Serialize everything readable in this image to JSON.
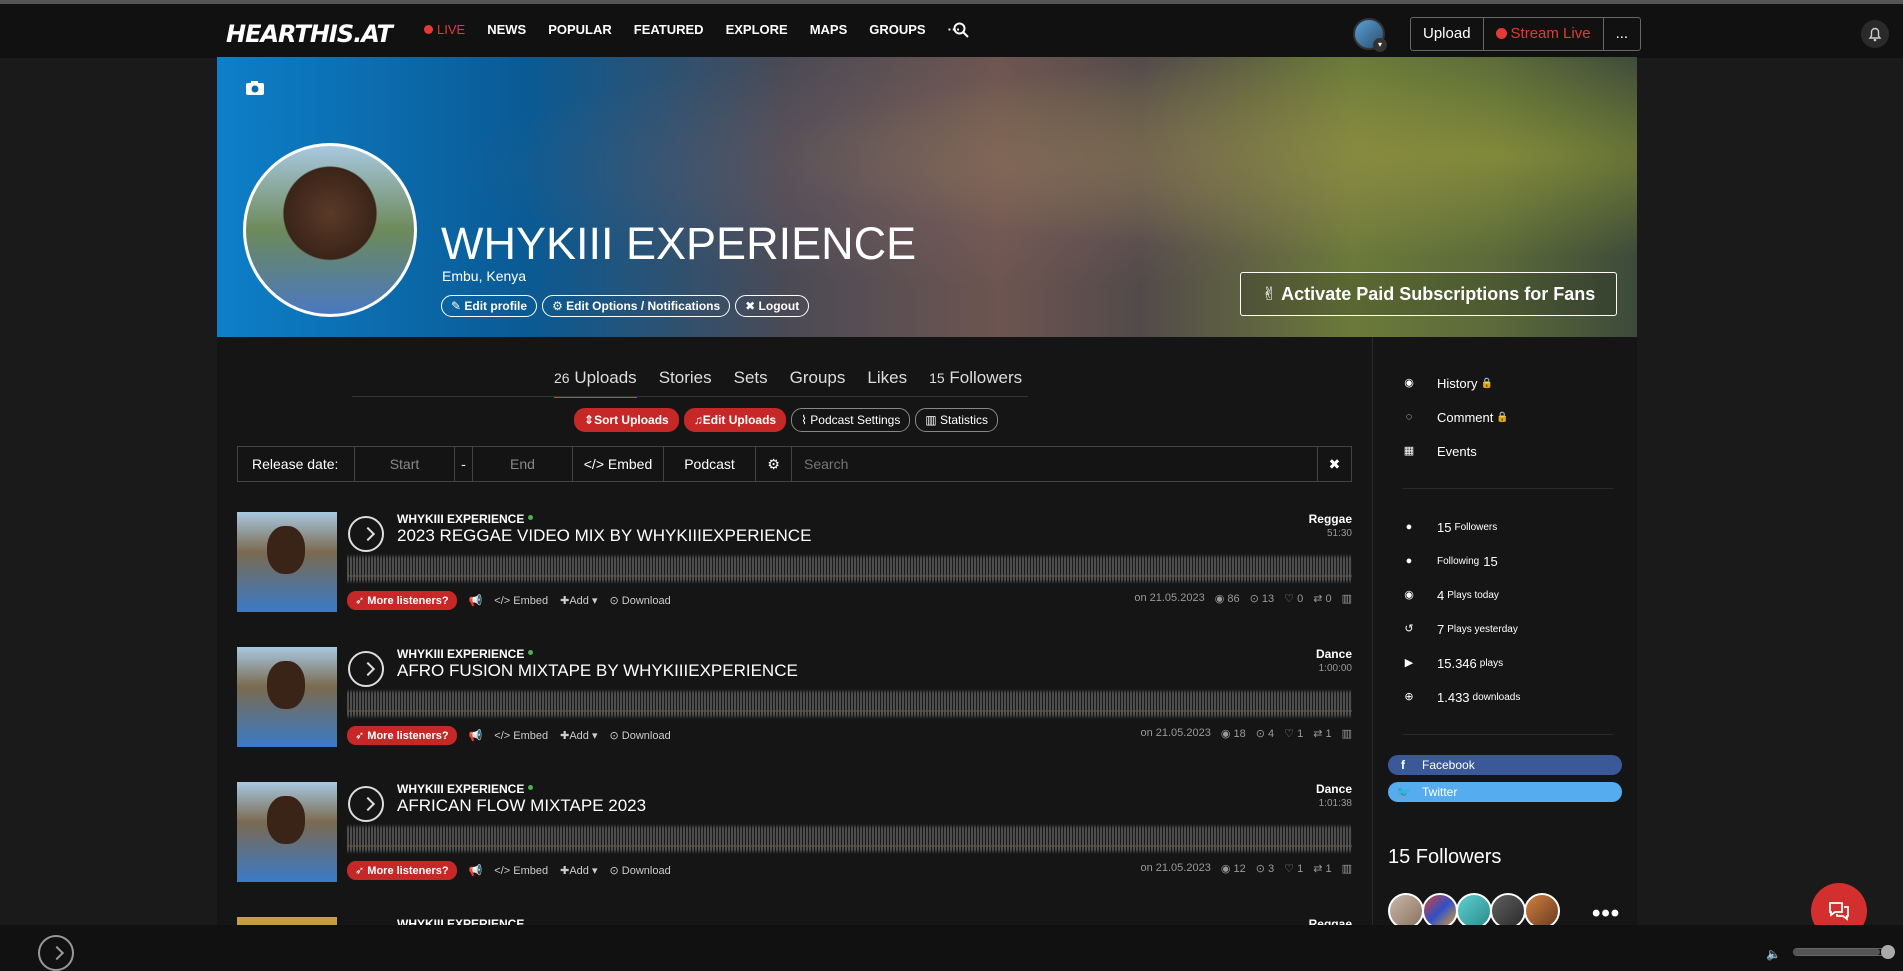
{
  "topbar": {
    "logo": "HEARTHIS.AT",
    "nav": [
      "LIVE",
      "NEWS",
      "POPULAR",
      "FEATURED",
      "EXPLORE",
      "MAPS",
      "GROUPS",
      "···"
    ],
    "upload_label": "Upload",
    "stream_label": "Stream Live",
    "more_label": "..."
  },
  "profile": {
    "name": "WHYKIII EXPERIENCE",
    "location": "Embu, Kenya",
    "edit_profile": "Edit profile",
    "edit_options": "Edit Options / Notifications",
    "logout": "Logout",
    "paid_subscriptions": "Activate Paid Subscriptions for Fans"
  },
  "tabs": [
    {
      "count": "26",
      "label": "Uploads"
    },
    {
      "count": "",
      "label": "Stories"
    },
    {
      "count": "",
      "label": "Sets"
    },
    {
      "count": "",
      "label": "Groups"
    },
    {
      "count": "",
      "label": "Likes"
    },
    {
      "count": "15",
      "label": "Followers"
    }
  ],
  "subactions": {
    "sort": "Sort Uploads",
    "edit": "Edit Uploads",
    "podcast_settings": "Podcast Settings",
    "statistics": "Statistics"
  },
  "filter": {
    "label": "Release date:",
    "start": "Start",
    "dash": "-",
    "end": "End",
    "embed": "Embed",
    "podcast": "Podcast",
    "search_placeholder": "Search",
    "clear": "✖"
  },
  "tracks": [
    {
      "artist": "WHYKIII EXPERIENCE",
      "title": "2023 REGGAE VIDEO MIX BY WHYKIIIEXPERIENCE",
      "genre": "Reggae",
      "duration": "51:30",
      "more_listeners": "More listeners?",
      "embed": "Embed",
      "add": "Add",
      "download": "Download",
      "date": "on 21.05.2023",
      "plays": "86",
      "downloads": "13",
      "likes": "0",
      "reposts": "0"
    },
    {
      "artist": "WHYKIII EXPERIENCE",
      "title": "AFRO FUSION MIXTAPE BY WHYKIIIEXPERIENCE",
      "genre": "Dance",
      "duration": "1:00:00",
      "more_listeners": "More listeners?",
      "embed": "Embed",
      "add": "Add",
      "download": "Download",
      "date": "on 21.05.2023",
      "plays": "18",
      "downloads": "4",
      "likes": "1",
      "reposts": "1"
    },
    {
      "artist": "WHYKIII EXPERIENCE",
      "title": "AFRICAN FLOW MIXTAPE 2023",
      "genre": "Dance",
      "duration": "1:01:38",
      "more_listeners": "More listeners?",
      "embed": "Embed",
      "add": "Add",
      "download": "Download",
      "date": "on 21.05.2023",
      "plays": "12",
      "downloads": "3",
      "likes": "1",
      "reposts": "1"
    },
    {
      "artist": "WHYKIII EXPERIENCE",
      "title": "",
      "genre": "Reggae",
      "duration": ""
    }
  ],
  "sidebar": {
    "links": [
      "History",
      "Comment",
      "Events"
    ],
    "stats": [
      {
        "value": "15",
        "label": "Followers"
      },
      {
        "value": "Following",
        "label": "15"
      },
      {
        "value": "4",
        "label": "Plays today"
      },
      {
        "value": "7",
        "label": "Plays yesterday"
      },
      {
        "value": "15.346",
        "label": "plays"
      },
      {
        "value": "1.433",
        "label": "downloads"
      }
    ],
    "facebook": "Facebook",
    "twitter": "Twitter",
    "followers_heading": "15 Followers",
    "more": "•••"
  },
  "player": {
    "volume": 0.9
  },
  "colors": {
    "accent": "#e53935",
    "facebook": "#3b5998",
    "twitter": "#55acee"
  }
}
